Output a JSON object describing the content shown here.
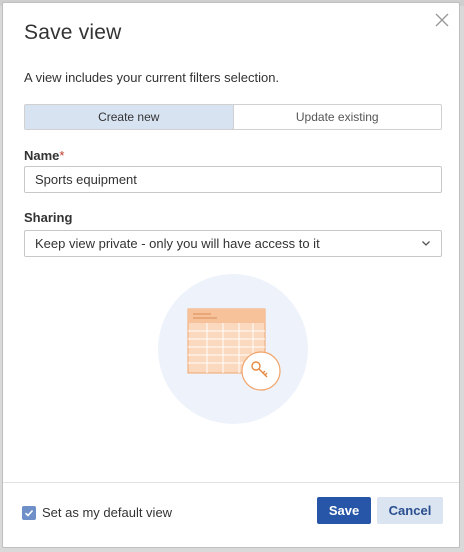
{
  "dialog": {
    "title": "Save view",
    "subtitle": "A view includes your current filters selection."
  },
  "mode_toggle": {
    "options": [
      "Create new",
      "Update existing"
    ],
    "selected": "Create new"
  },
  "name_field": {
    "label": "Name",
    "required_marker": "*",
    "value": "Sports equipment"
  },
  "sharing_field": {
    "label": "Sharing",
    "value": "Keep view private - only you will have access to it"
  },
  "footer": {
    "default_checkbox_label": "Set as my default view",
    "default_checked": true,
    "save_label": "Save",
    "cancel_label": "Cancel"
  },
  "colors": {
    "primary": "#2756a8",
    "accent_light": "#d8e3f2",
    "illustration_orange": "#f4a261",
    "illustration_bg": "#eef3fb"
  },
  "icons": [
    "close-icon",
    "chevron-down-icon",
    "checkmark-icon",
    "table-illustration-icon",
    "key-icon"
  ]
}
